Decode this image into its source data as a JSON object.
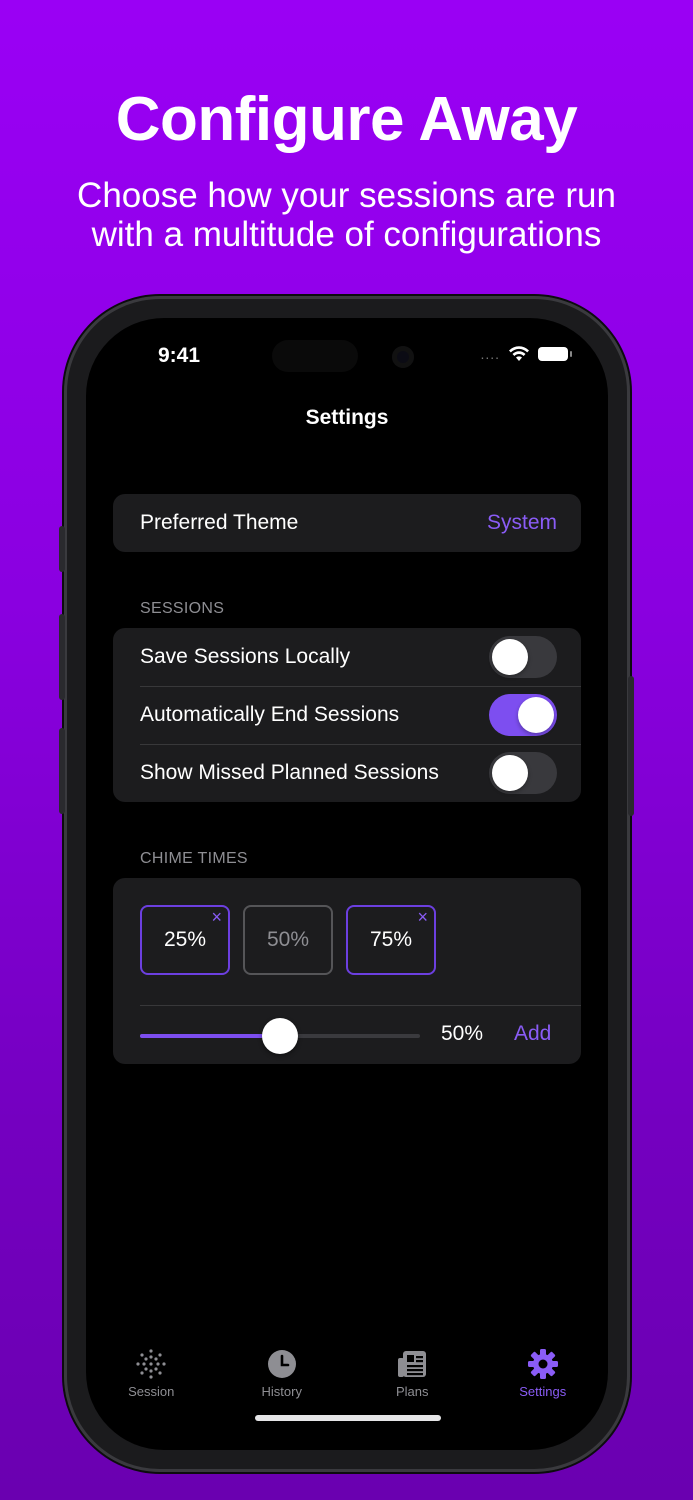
{
  "headline": "Configure Away",
  "subline": [
    "Choose how your sessions are run",
    "with a multitude of configurations"
  ],
  "status": {
    "time": "9:41",
    "dots": "...."
  },
  "nav": {
    "title": "Settings"
  },
  "theme": {
    "label": "Preferred Theme",
    "value": "System"
  },
  "sessions": {
    "header": "SESSIONS",
    "items": [
      {
        "label": "Save Sessions Locally",
        "on": false
      },
      {
        "label": "Automatically End Sessions",
        "on": true
      },
      {
        "label": "Show Missed Planned Sessions",
        "on": false
      }
    ]
  },
  "chime": {
    "header": "CHIME TIMES",
    "chips": [
      {
        "label": "25%",
        "active": true,
        "remove": "×"
      },
      {
        "label": "50%",
        "active": false,
        "remove": ""
      },
      {
        "label": "75%",
        "active": true,
        "remove": "×"
      }
    ],
    "slider_percent": 50,
    "slider_label": "50%",
    "add_label": "Add"
  },
  "tabs": [
    {
      "label": "Session",
      "icon": "session-dots-icon",
      "active": false
    },
    {
      "label": "History",
      "icon": "clock-icon",
      "active": false
    },
    {
      "label": "Plans",
      "icon": "newspaper-icon",
      "active": false
    },
    {
      "label": "Settings",
      "icon": "gear-icon",
      "active": true
    }
  ],
  "colors": {
    "accent": "#8a5cf6",
    "background_top": "#9a00f5",
    "background_bottom": "#6a00b0"
  }
}
